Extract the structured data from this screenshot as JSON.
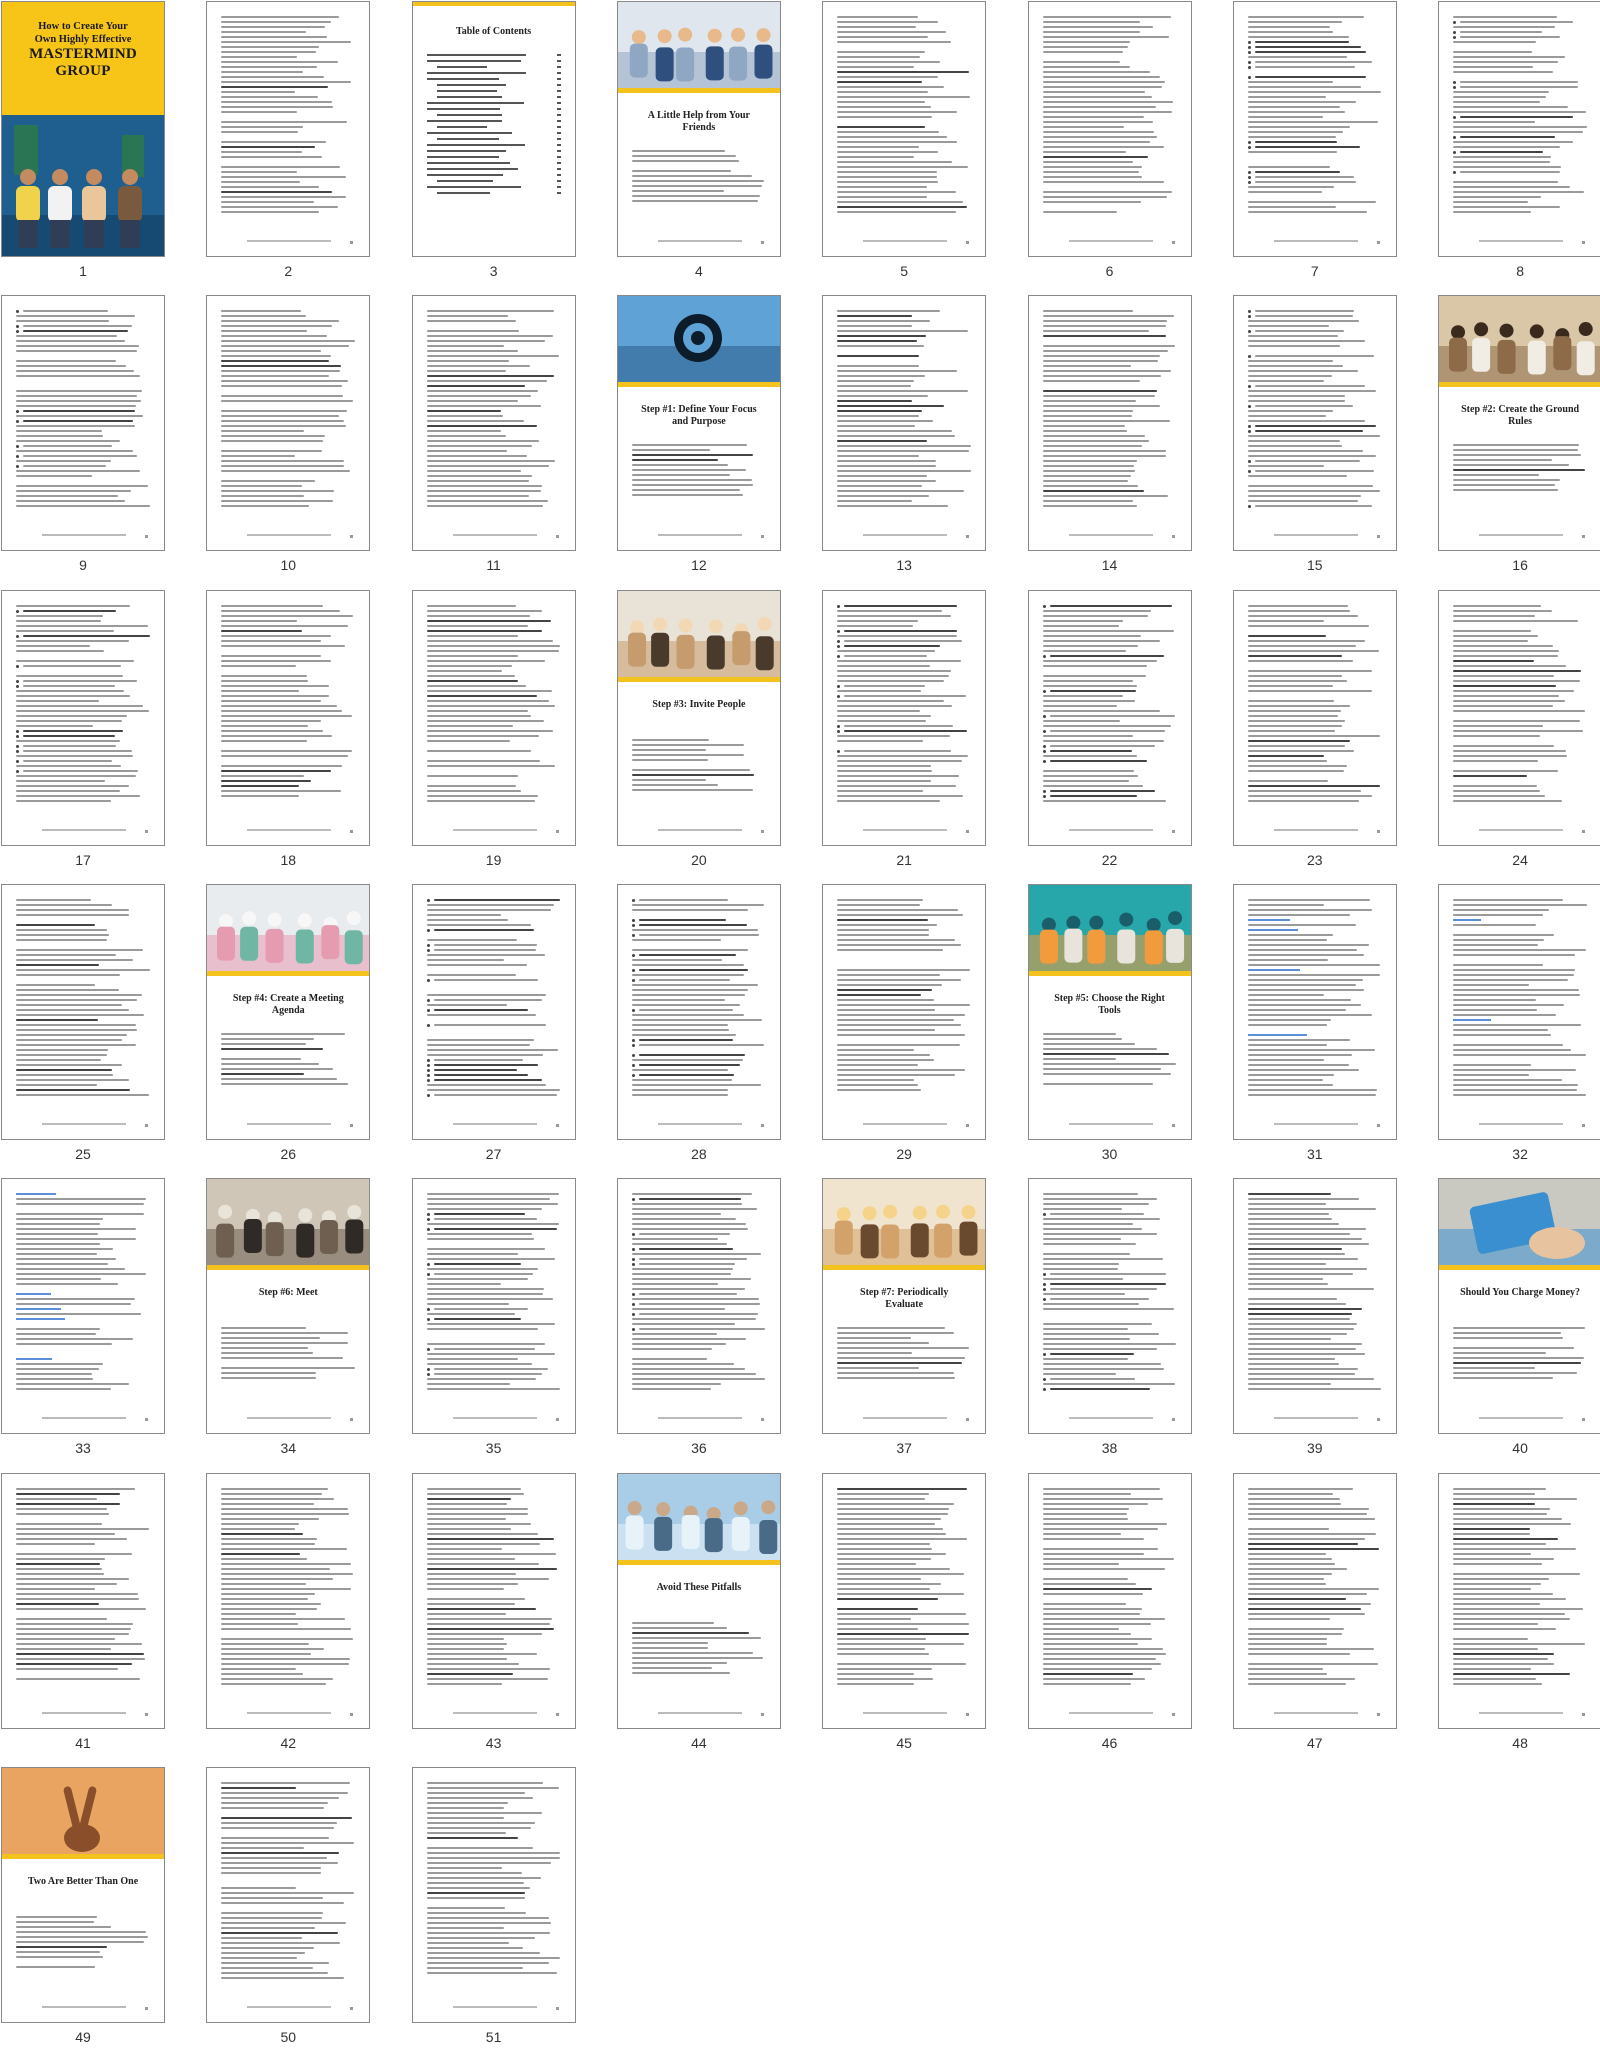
{
  "document": {
    "cover_title_line1": "How to Create Your",
    "cover_title_line2": "Own Highly Effective",
    "cover_title_line3": "MASTERMIND",
    "cover_title_line4": "GROUP",
    "toc_title": "Table of Contents"
  },
  "pages": [
    {
      "num": "1",
      "kind": "cover"
    },
    {
      "num": "2",
      "kind": "text"
    },
    {
      "num": "3",
      "kind": "toc"
    },
    {
      "num": "4",
      "kind": "chapter",
      "title": "A Little Help from Your Friends",
      "photo": "group"
    },
    {
      "num": "5",
      "kind": "text"
    },
    {
      "num": "6",
      "kind": "text"
    },
    {
      "num": "7",
      "kind": "text"
    },
    {
      "num": "8",
      "kind": "text"
    },
    {
      "num": "9",
      "kind": "text"
    },
    {
      "num": "10",
      "kind": "text"
    },
    {
      "num": "11",
      "kind": "text"
    },
    {
      "num": "12",
      "kind": "chapter",
      "title": "Step #1: Define Your Focus and Purpose",
      "photo": "lens"
    },
    {
      "num": "13",
      "kind": "text"
    },
    {
      "num": "14",
      "kind": "text"
    },
    {
      "num": "15",
      "kind": "text"
    },
    {
      "num": "16",
      "kind": "chapter",
      "title": "Step #2: Create the Ground Rules",
      "photo": "writing"
    },
    {
      "num": "17",
      "kind": "text"
    },
    {
      "num": "18",
      "kind": "text"
    },
    {
      "num": "19",
      "kind": "text"
    },
    {
      "num": "20",
      "kind": "chapter",
      "title": "Step #3: Invite People",
      "photo": "meeting"
    },
    {
      "num": "21",
      "kind": "text"
    },
    {
      "num": "22",
      "kind": "text"
    },
    {
      "num": "23",
      "kind": "text"
    },
    {
      "num": "24",
      "kind": "text"
    },
    {
      "num": "25",
      "kind": "text"
    },
    {
      "num": "26",
      "kind": "chapter",
      "title": "Step #4: Create a Meeting Agenda",
      "photo": "flowers"
    },
    {
      "num": "27",
      "kind": "text"
    },
    {
      "num": "28",
      "kind": "text"
    },
    {
      "num": "29",
      "kind": "text"
    },
    {
      "num": "30",
      "kind": "chapter",
      "title": "Step #5: Choose the Right Tools",
      "photo": "laptop"
    },
    {
      "num": "31",
      "kind": "text"
    },
    {
      "num": "32",
      "kind": "text"
    },
    {
      "num": "33",
      "kind": "text"
    },
    {
      "num": "34",
      "kind": "chapter",
      "title": "Step #6: Meet",
      "photo": "audience"
    },
    {
      "num": "35",
      "kind": "text"
    },
    {
      "num": "36",
      "kind": "text"
    },
    {
      "num": "37",
      "kind": "chapter",
      "title": "Step #7: Periodically Evaluate",
      "photo": "hands"
    },
    {
      "num": "38",
      "kind": "text"
    },
    {
      "num": "39",
      "kind": "text"
    },
    {
      "num": "40",
      "kind": "chapter",
      "title": "Should You Charge Money?",
      "photo": "card"
    },
    {
      "num": "41",
      "kind": "text"
    },
    {
      "num": "42",
      "kind": "text"
    },
    {
      "num": "43",
      "kind": "text"
    },
    {
      "num": "44",
      "kind": "chapter",
      "title": "Avoid These Pitfalls",
      "photo": "sky"
    },
    {
      "num": "45",
      "kind": "text"
    },
    {
      "num": "46",
      "kind": "text"
    },
    {
      "num": "47",
      "kind": "text"
    },
    {
      "num": "48",
      "kind": "text"
    },
    {
      "num": "49",
      "kind": "chapter",
      "title": "Two Are Better Than One",
      "photo": "peace"
    },
    {
      "num": "50",
      "kind": "text"
    },
    {
      "num": "51",
      "kind": "text"
    }
  ],
  "colors": {
    "accent": "#f4c21c",
    "page_border": "#8a8a8a",
    "text_line": "#9a9a9a",
    "link": "#5b8fd9"
  }
}
